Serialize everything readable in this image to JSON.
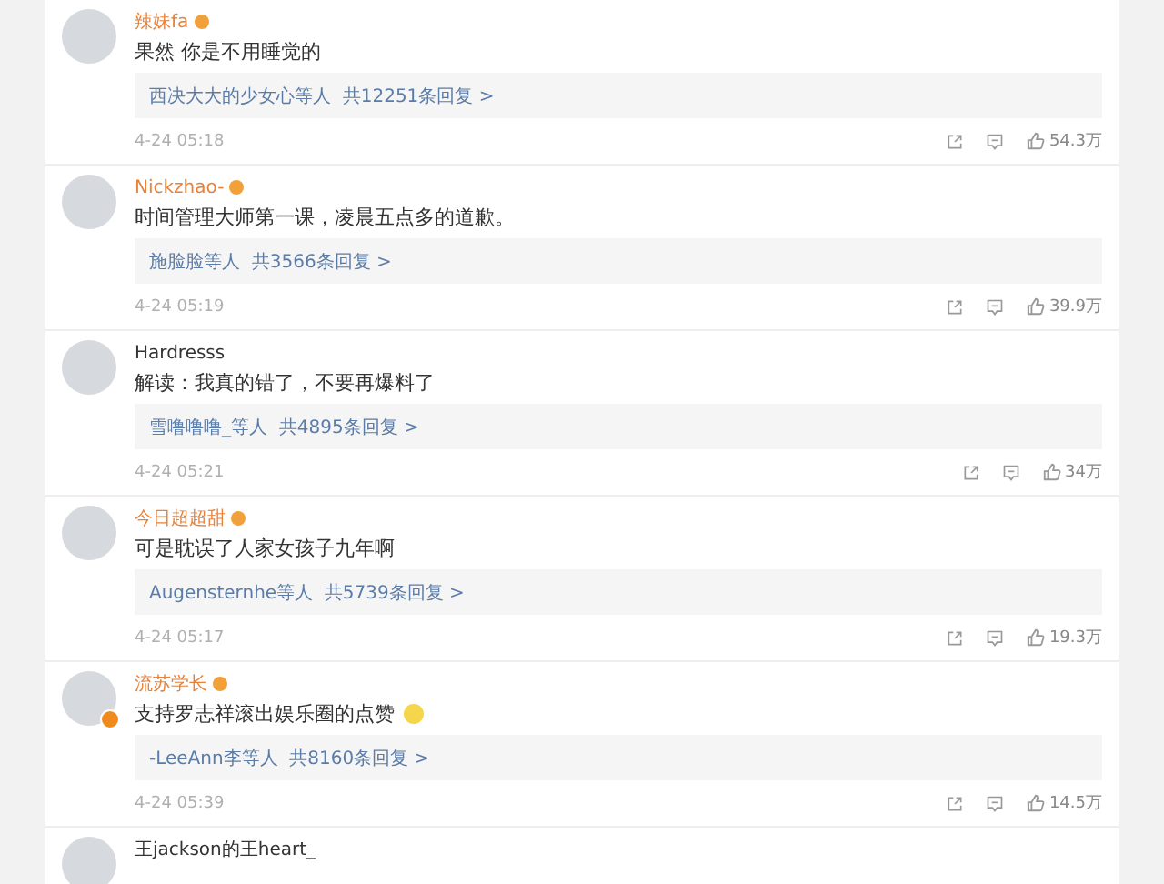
{
  "comments": [
    {
      "name": "辣妹fa",
      "vip": true,
      "text": "果然 你是不用睡觉的",
      "replies": "西决大大的少女心等人  共12251条回复 >",
      "time": "4-24 05:18",
      "likes": "54.3万"
    },
    {
      "name": "Nickzhao-",
      "vip": true,
      "text": "时间管理大师第一课，凌晨五点多的道歉。",
      "replies": "施脸脸等人  共3566条回复 >",
      "time": "4-24 05:19",
      "likes": "39.9万"
    },
    {
      "name": "Hardresss",
      "vip": false,
      "text": "解读：我真的错了，不要再爆料了",
      "replies": "雪噜噜噜_等人  共4895条回复 >",
      "time": "4-24 05:21",
      "likes": "34万"
    },
    {
      "name": "今日超超甜",
      "vip": true,
      "text": "可是耽误了人家女孩子九年啊",
      "replies": "Augensternhe等人  共5739条回复 >",
      "time": "4-24 05:17",
      "likes": "19.3万"
    },
    {
      "name": "流苏学长",
      "vip": true,
      "verified": true,
      "text": "支持罗志祥滚出娱乐圈的点赞",
      "emoji": true,
      "replies": "-LeeAnn李等人  共8160条回复 >",
      "time": "4-24 05:39",
      "likes": "14.5万"
    },
    {
      "name": "王jackson的王heart_",
      "vip": false
    }
  ]
}
